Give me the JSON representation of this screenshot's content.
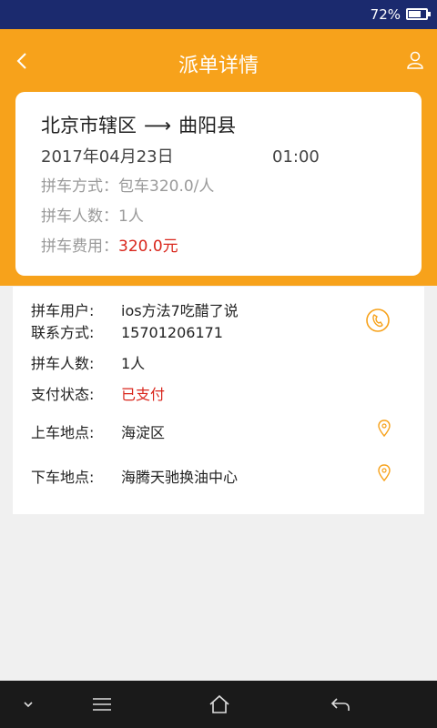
{
  "status_bar": {
    "battery_text": "72%",
    "battery_level": 0.72
  },
  "header": {
    "title": "派单详情"
  },
  "trip": {
    "from": "北京市辖区",
    "arrow": "⟶",
    "to": "曲阳县",
    "date": "2017年04月23日",
    "time": "01:00",
    "mode_label": "拼车方式：",
    "mode_value": "包车320.0/人",
    "count_label": "拼车人数：",
    "count_value": "1人",
    "fee_label": "拼车费用：",
    "fee_value": "320.0元"
  },
  "details": {
    "user_label": "拼车用户:",
    "user_value": "ios方法7吃醋了说",
    "contact_label": "联系方式:",
    "contact_value": "15701206171",
    "count_label": "拼车人数:",
    "count_value": "1人",
    "pay_label": "支付状态:",
    "pay_value": "已支付",
    "pickup_label": "上车地点:",
    "pickup_value": "海淀区",
    "dropoff_label": "下车地点:",
    "dropoff_value": "海腾天驰换油中心"
  },
  "colors": {
    "accent": "#f7a21b",
    "status_bar": "#1b2a6e",
    "red": "#d9261c"
  },
  "icons": [
    "back-arrow-icon",
    "user-icon",
    "phone-icon",
    "location-pin-icon",
    "chevron-down-icon",
    "menu-icon",
    "home-icon",
    "back-icon"
  ]
}
